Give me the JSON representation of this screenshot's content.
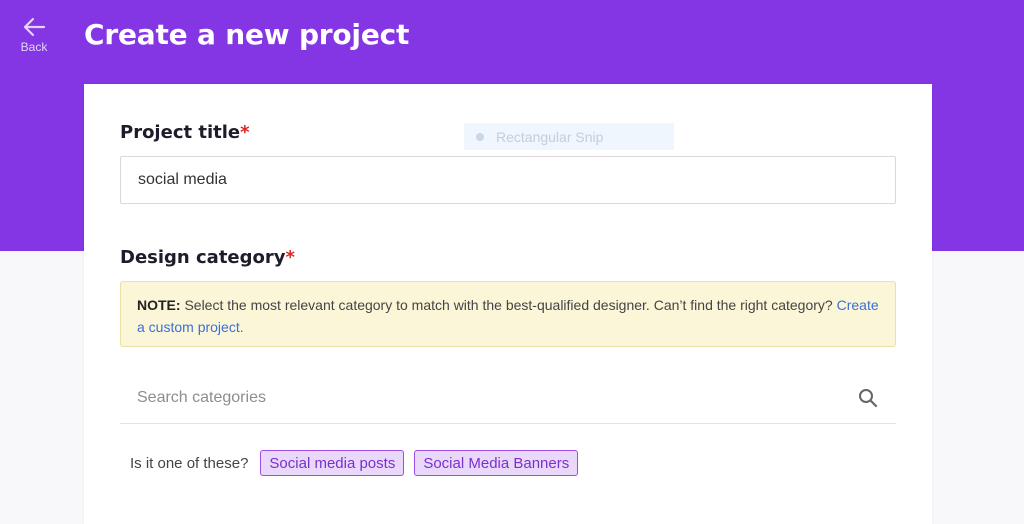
{
  "header": {
    "back_label": "Back",
    "title": "Create a new project"
  },
  "overlay": {
    "snip_label": "Rectangular Snip"
  },
  "form": {
    "project_title": {
      "label": "Project title",
      "required_mark": "*",
      "value": "social media"
    },
    "design_category": {
      "label": "Design category",
      "required_mark": "*",
      "note": {
        "prefix": "NOTE:",
        "text": " Select the most relevant category to match with the best-qualified designer. Can’t find the right category? ",
        "link": "Create a custom project.",
        "suffix": ""
      },
      "search": {
        "placeholder": "Search categories",
        "value": ""
      },
      "suggestions": {
        "prompt": "Is it one of these?",
        "items": [
          "Social media posts",
          "Social Media Banners"
        ]
      }
    }
  },
  "colors": {
    "header_bg": "#8435e4",
    "required": "#d92626",
    "link": "#3b6fd6",
    "chip_bg": "#ead8fb",
    "chip_border": "#9b4fe6",
    "note_bg": "#fbf6d8"
  },
  "icons": {
    "back": "arrow-left-icon",
    "search": "search-icon"
  }
}
